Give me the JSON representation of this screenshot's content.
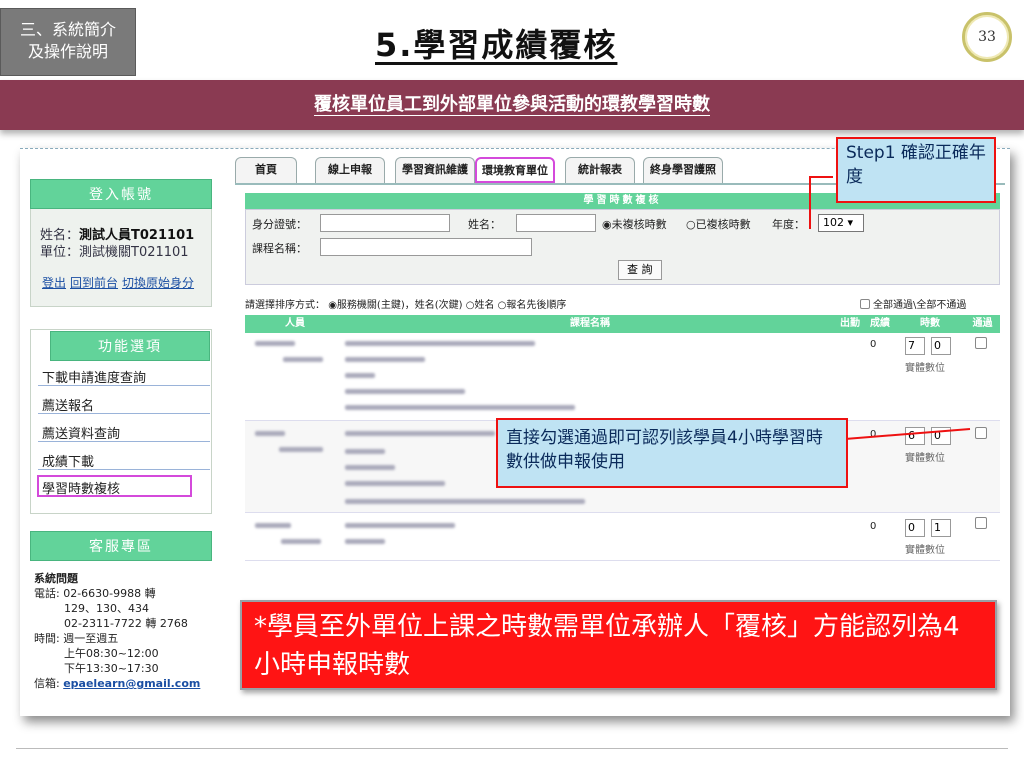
{
  "header": {
    "section_line1": "三、系統簡介",
    "section_line2": "及操作說明",
    "title": "5.學習成績覆核",
    "page_number": "33",
    "banner": "覆核單位員工到外部單位參與活動的環教學習時數"
  },
  "sidebar": {
    "login_title": "登入帳號",
    "name_label": "姓名：",
    "name_value": "測試人員T021101",
    "unit_label": "單位：",
    "unit_value": "測試機關T021101",
    "links": [
      "登出",
      "回到前台",
      "切換原始身分"
    ],
    "func_title": "功能選項",
    "func_items": [
      "下載申請進度查詢",
      "薦送報名",
      "薦送資料查詢",
      "成績下載",
      "學習時數複核"
    ],
    "service_title": "客服專區",
    "service_heading": "系統問題",
    "phone_label": "電話: 02-6630-9988 轉",
    "phone_ext": "129、130、434",
    "phone2": "02-2311-7722 轉 2768",
    "time_label": "時間: 週一至週五",
    "time_am": "上午08:30~12:00",
    "time_pm": "下午13:30~17:30",
    "email_label": "信箱: ",
    "email": "epaelearn@gmail.com"
  },
  "tabs": [
    "首頁",
    "線上申報",
    "學習資訊維護",
    "環境教育單位",
    "統計報表",
    "終身學習護照"
  ],
  "form": {
    "title": "學習時數複核",
    "id_label": "身分證號：",
    "name_label": "姓名：",
    "course_label": "課程名稱：",
    "radio_unreviewed": "未複核時數",
    "radio_reviewed": "已複核時數",
    "year_label": "年度：",
    "year_value": "102 ▾",
    "search_button": "查 詢"
  },
  "sort": {
    "label": "請選擇排序方式：",
    "opt1": "服務機關(主鍵)，姓名(次鍵)",
    "opt2": "姓名",
    "opt3": "報名先後順序",
    "pass_all": "全部通過\\全部不通過"
  },
  "table": {
    "headers": [
      "人員",
      "課程名稱",
      "出勤",
      "成績",
      "時數",
      "通過"
    ],
    "rows": [
      {
        "score": "0",
        "hours": "7",
        "minutes": "0",
        "unit": "實體數位"
      },
      {
        "score": "0",
        "hours": "6",
        "minutes": "0",
        "unit": "實體數位"
      },
      {
        "score": "0",
        "hours": "0",
        "minutes": "1",
        "unit": "實體數位"
      }
    ]
  },
  "callouts": {
    "step1": "Step1 確認正確年度",
    "check": "直接勾選通過即可認列該學員4小時學習時數供做申報使用",
    "notice": "*學員至外單位上課之時數需單位承辦人「覆核」方能認列為4小時申報時數"
  },
  "colors": {
    "banner": "#8a3a52",
    "panel_green": "#62d39a",
    "notice_red": "#ff1414",
    "highlight_magenta": "#d44adb",
    "callout_blue": "#bfe3f3"
  }
}
